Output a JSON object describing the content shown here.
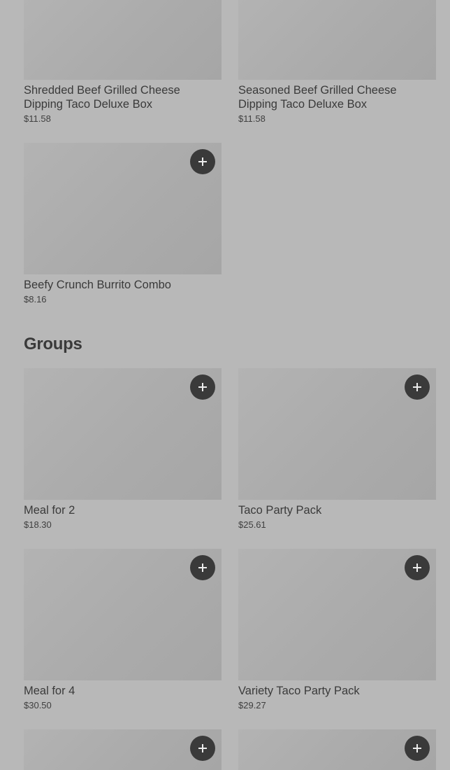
{
  "top_items": [
    {
      "name": "Shredded Beef Grilled Cheese Dipping Taco Deluxe Box",
      "price": "$11.58"
    },
    {
      "name": "Seasoned Beef Grilled Cheese Dipping Taco Deluxe Box",
      "price": "$11.58"
    },
    {
      "name": "Beefy Crunch Burrito Combo",
      "price": "$8.16"
    }
  ],
  "groups": {
    "title": "Groups",
    "items": [
      {
        "name": "Meal for 2",
        "price": "$18.30"
      },
      {
        "name": "Taco Party Pack",
        "price": "$25.61"
      },
      {
        "name": "Meal for 4",
        "price": "$30.50"
      },
      {
        "name": "Variety Taco Party Pack",
        "price": "$29.27"
      },
      {
        "name": "",
        "price": ""
      },
      {
        "name": "",
        "price": ""
      }
    ]
  },
  "icons": {
    "add": "plus-icon"
  }
}
